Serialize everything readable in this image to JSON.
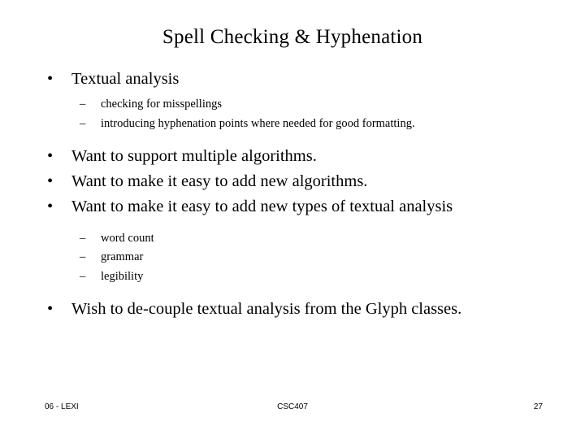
{
  "slide": {
    "title": "Spell Checking & Hyphenation",
    "bullet_marker": "•",
    "sub_bullet_marker": "–",
    "content": [
      {
        "level": 1,
        "text": "Textual analysis",
        "gap_before": false
      },
      {
        "level": 2,
        "text": "checking for misspellings",
        "group": "a"
      },
      {
        "level": 2,
        "text": "introducing hyphenation points where needed for good formatting.",
        "group": "a"
      },
      {
        "level": 1,
        "text": "Want to support multiple algorithms.",
        "gap_before": true
      },
      {
        "level": 1,
        "text": "Want to make it easy to add new algorithms.",
        "gap_before": false
      },
      {
        "level": 1,
        "text": "Want to make it easy to add new types of textual analysis",
        "gap_before": false
      },
      {
        "level": 2,
        "text": "word count",
        "group": "b"
      },
      {
        "level": 2,
        "text": "grammar",
        "group": "b"
      },
      {
        "level": 2,
        "text": "legibility",
        "group": "b"
      },
      {
        "level": 1,
        "text": "Wish to de-couple textual analysis from the Glyph classes.",
        "gap_before": true
      }
    ]
  },
  "footer": {
    "left": "06 - LEXI",
    "center": "CSC407",
    "right": "27"
  },
  "colors": {
    "background": "#ffffff",
    "text": "#000000"
  }
}
